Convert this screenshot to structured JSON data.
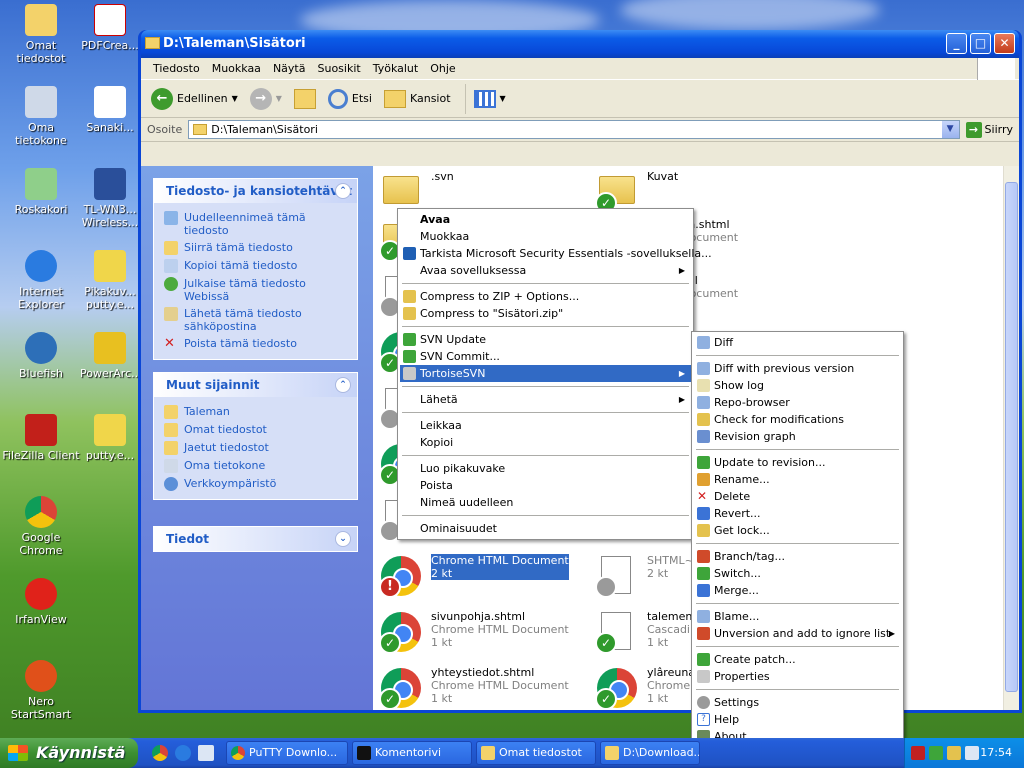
{
  "desktop": {
    "icons": [
      {
        "label": "Omat tiedostot"
      },
      {
        "label": "PDFCrea..."
      },
      {
        "label": "Oma tietokone"
      },
      {
        "label": "Sanaki..."
      },
      {
        "label": "Roskakori"
      },
      {
        "label": "TL-WN3... Wireless..."
      },
      {
        "label": "Internet Explorer"
      },
      {
        "label": "Pikakuv... putty.e..."
      },
      {
        "label": "Bluefish"
      },
      {
        "label": "PowerArc..."
      },
      {
        "label": "FileZilla Client"
      },
      {
        "label": "putty.e..."
      },
      {
        "label": "Google Chrome"
      },
      {
        "label": "IrfanView"
      },
      {
        "label": "Nero StartSmart"
      }
    ]
  },
  "window": {
    "title": "D:\\Taleman\\Sisätori",
    "controls": {
      "minimize": "_",
      "maximize": "□",
      "close": "✕"
    },
    "menubar": [
      "Tiedosto",
      "Muokkaa",
      "Näytä",
      "Suosikit",
      "Työkalut",
      "Ohje"
    ],
    "toolbar": {
      "back": "Edellinen",
      "search": "Etsi",
      "folders": "Kansiot"
    },
    "address": {
      "label": "Osoite",
      "value": "D:\\Taleman\\Sisätori",
      "go": "Siirry"
    }
  },
  "left_panel": {
    "tasks": {
      "title": "Tiedosto- ja kansiotehtävät",
      "items": [
        "Uudelleennimeä tämä tiedosto",
        "Siirrä tämä tiedosto",
        "Kopioi tämä tiedosto",
        "Julkaise tämä tiedosto Webissä",
        "Lähetä tämä tiedosto sähköpostina",
        "Poista tämä tiedosto"
      ]
    },
    "places": {
      "title": "Muut sijainnit",
      "items": [
        "Taleman",
        "Omat tiedostot",
        "Jaetut tiedostot",
        "Oma tietokone",
        "Verkkoympäristö"
      ]
    },
    "details": {
      "title": "Tiedot"
    }
  },
  "files": [
    {
      "name": ".svn",
      "type": "",
      "size": ""
    },
    {
      "name": "Kuvat",
      "type": "",
      "size": ""
    },
    {
      "name": "alareuna.shtml",
      "type": "HTML Document",
      "size": ""
    },
    {
      "name": "...c.shtml",
      "type": "HTML Document",
      "size": ""
    },
    {
      "name": "",
      "type": "HTML Document",
      "size": ""
    },
    {
      "name": "",
      "type": "Chrome HTML Document",
      "size": "2 kt"
    },
    {
      "name": "",
      "type": "SHTML~...",
      "size": "2 kt"
    },
    {
      "name": "sivunpohja.shtml",
      "type": "Chrome HTML Document",
      "size": "1 kt"
    },
    {
      "name": "talemenu...",
      "type": "Cascadin...",
      "size": "1 kt"
    },
    {
      "name": "yhteystiedot.shtml",
      "type": "Chrome HTML Document",
      "size": "1 kt"
    },
    {
      "name": "ylâreuna...",
      "type": "Chrome H...",
      "size": "1 kt"
    }
  ],
  "context_menu": {
    "groups": [
      [
        "Avaa",
        "Muokkaa",
        "Tarkista Microsoft Security Essentials -sovelluksella...",
        "Avaa sovelluksessa"
      ],
      [
        "Compress to ZIP + Options...",
        "Compress to \"Sisätori.zip\""
      ],
      [
        "SVN Update",
        "SVN Commit...",
        "TortoiseSVN"
      ],
      [
        "Lähetä"
      ],
      [
        "Leikkaa",
        "Kopioi"
      ],
      [
        "Luo pikakuvake",
        "Poista",
        "Nimeä uudelleen"
      ],
      [
        "Ominaisuudet"
      ]
    ]
  },
  "svn_submenu": {
    "groups": [
      [
        "Diff"
      ],
      [
        "Diff with previous version",
        "Show log",
        "Repo-browser",
        "Check for modifications",
        "Revision graph"
      ],
      [
        "Update to revision...",
        "Rename...",
        "Delete",
        "Revert...",
        "Get lock..."
      ],
      [
        "Branch/tag...",
        "Switch...",
        "Merge..."
      ],
      [
        "Blame...",
        "Unversion and add to ignore list"
      ],
      [
        "Create patch...",
        "Properties"
      ],
      [
        "Settings",
        "Help",
        "About"
      ]
    ]
  },
  "taskbar": {
    "start": "Käynnistä",
    "tasks": [
      "PuTTY Downlo...",
      "Komentorivi",
      "Omat tiedostot",
      "D:\\Download..."
    ],
    "clock": "17:54"
  },
  "colors": {
    "highlight": "#316ac5",
    "xp_blue": "#0a46d6",
    "link": "#215dc6"
  }
}
